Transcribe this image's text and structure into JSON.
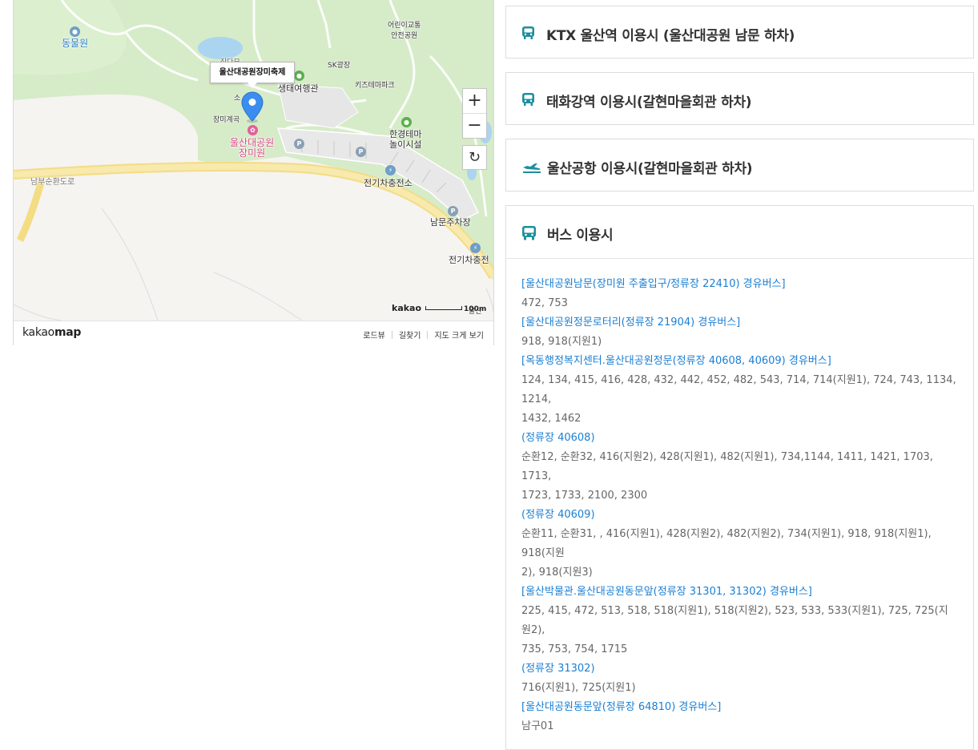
{
  "map": {
    "marker_label": "울산대공원장미축제",
    "labels": {
      "zoo": "동물원",
      "kids_traffic": "어린이교통\n안전공원",
      "sk_plaza": "SK광장",
      "eco_travel": "생태여행관",
      "kids_theme": "키즈테마파크",
      "rose_valley": "장미계곡",
      "park_rose": "울산대공원\n장미원",
      "env_theme": "한경테마\n놀이시설",
      "ev_charge_1": "전기차충전소",
      "ev_charge_2": "전기차충전",
      "south_parking": "남문주차장",
      "road": "남부순환도로",
      "cut_1": "장다모",
      "cut_2": "소",
      "cut_3": "울산"
    },
    "zoom_in": "+",
    "zoom_out": "−",
    "refresh": "↻",
    "scale_brand": "kakao",
    "scale_value": "100m",
    "logo_a": "kakao",
    "logo_b": "map",
    "footer_links": [
      "로드뷰",
      "길찾기",
      "지도 크게 보기"
    ]
  },
  "directions": [
    {
      "title": "KTX 울산역 이용시 (울산대공원 남문 하차)",
      "icon": "bus-icon"
    },
    {
      "title": "태화강역 이용시(갈현마을회관 하차)",
      "icon": "bus-icon"
    },
    {
      "title": "울산공항 이용시(갈현마을회관 하차)",
      "icon": "airplane-icon"
    }
  ],
  "bus": {
    "title": "버스 이용시",
    "icon": "bus-icon",
    "stops": [
      {
        "stop": "[울산대공원남문(장미원 주출입구/정류장 22410) 경유버스]",
        "routes": [
          "472, 753"
        ]
      },
      {
        "stop": "[울산대공원정문로터리(정류장 21904) 경유버스]",
        "routes": [
          "918, 918(지원1)"
        ]
      },
      {
        "stop": "[옥동행정복지센터.울산대공원정문(정류장 40608, 40609) 경유버스]",
        "routes": [
          "124, 134, 415, 416, 428, 432, 442, 452, 482, 543, 714, 714(지원1), 724, 743, 1134, 1214,",
          "1432, 1462"
        ]
      },
      {
        "stop": "(정류장 40608)",
        "routes": [
          "순환12, 순환32, 416(지원2), 428(지원1), 482(지원1), 734,1144, 1411, 1421, 1703, 1713,",
          "1723, 1733, 2100, 2300"
        ]
      },
      {
        "stop": "(정류장 40609)",
        "routes": [
          "순환11, 순환31, , 416(지원1), 428(지원2), 482(지원2), 734(지원1), 918, 918(지원1), 918(지원",
          "2), 918(지원3)"
        ]
      },
      {
        "stop": "[울산박물관.울산대공원동문앞(정류장 31301, 31302) 경유버스]",
        "routes": [
          "225, 415, 472, 513, 518, 518(지원1), 518(지원2), 523, 533, 533(지원1), 725, 725(지원2),",
          "735, 753, 754, 1715"
        ]
      },
      {
        "stop": "(정류장 31302)",
        "routes": [
          "716(지원1), 725(지원1)"
        ]
      },
      {
        "stop": "[울산대공원동문앞(정류장 64810) 경유버스]",
        "routes": [
          "남구01"
        ]
      }
    ]
  },
  "colors": {
    "park_green": "#d6ebc8",
    "road_yellow": "#f3dc84",
    "link_blue": "#1a7fd4",
    "icon_teal": "#1e8f9e",
    "marker_blue": "#3b8ef0"
  }
}
